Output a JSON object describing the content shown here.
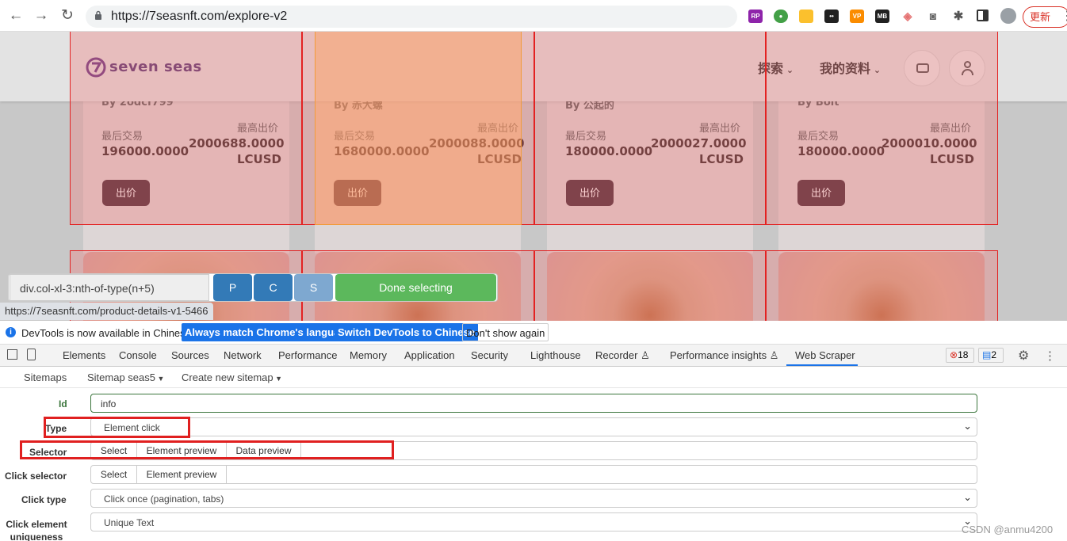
{
  "browser": {
    "url": "https://7seasnft.com/explore-v2",
    "update_label": "更新",
    "ext_rp": "RP",
    "ext_vp": "VP",
    "ext_mb": "MB"
  },
  "site": {
    "logo": "seven seas",
    "nav_explore": "探索",
    "nav_profile": "我的资料"
  },
  "cards": [
    {
      "by": "By 2odcf799",
      "last_label": "最后交易",
      "last_value": "196000.0000",
      "high_label": "最高出价",
      "high_value": "2000688.0000",
      "unit": "LCUSD",
      "bid": "出价"
    },
    {
      "by": "By 赤大螺",
      "last_label": "最后交易",
      "last_value": "1680000.0000",
      "high_label": "最高出价",
      "high_value": "2000088.0000",
      "unit": "LCUSD",
      "bid": "出价"
    },
    {
      "by": "By 公起的",
      "last_label": "最后交易",
      "last_value": "180000.0000",
      "high_label": "最高出价",
      "high_value": "2000027.0000",
      "unit": "LCUSD",
      "bid": "出价"
    },
    {
      "by": "By Bolt",
      "last_label": "最后交易",
      "last_value": "180000.0000",
      "high_label": "最高出价",
      "high_value": "2000010.0000",
      "unit": "LCUSD",
      "bid": "出价"
    }
  ],
  "scraper_bar": {
    "selector": "div.col-xl-3:nth-of-type(n+5)",
    "p": "P",
    "c": "C",
    "s": "S",
    "done": "Done selecting"
  },
  "status_url": "https://7seasnft.com/product-details-v1-5466",
  "infobar": {
    "text": "DevTools is now available in Chinese!",
    "btn1": "Always match Chrome's language",
    "btn2": "Switch DevTools to Chinese",
    "btn3": "Don't show again"
  },
  "tabs": [
    "Elements",
    "Console",
    "Sources",
    "Network",
    "Performance",
    "Memory",
    "Application",
    "Security",
    "Lighthouse",
    "Recorder",
    "Performance insights",
    "Web Scraper"
  ],
  "badges": {
    "errors": "18",
    "messages": "2"
  },
  "subnav": {
    "sitemaps": "Sitemaps",
    "sitemap": "Sitemap seas5",
    "create": "Create new sitemap"
  },
  "form": {
    "id_label": "Id",
    "id_value": "info",
    "type_label": "Type",
    "type_value": "Element click",
    "selector_label": "Selector",
    "select": "Select",
    "element_preview": "Element preview",
    "data_preview": "Data preview",
    "click_selector_label": "Click selector",
    "click_type_label": "Click type",
    "click_type_value": "Click once (pagination, tabs)",
    "click_unique_label": "Click element uniqueness",
    "click_unique_value": "Unique Text"
  },
  "watermark": "CSDN @anmu4200"
}
